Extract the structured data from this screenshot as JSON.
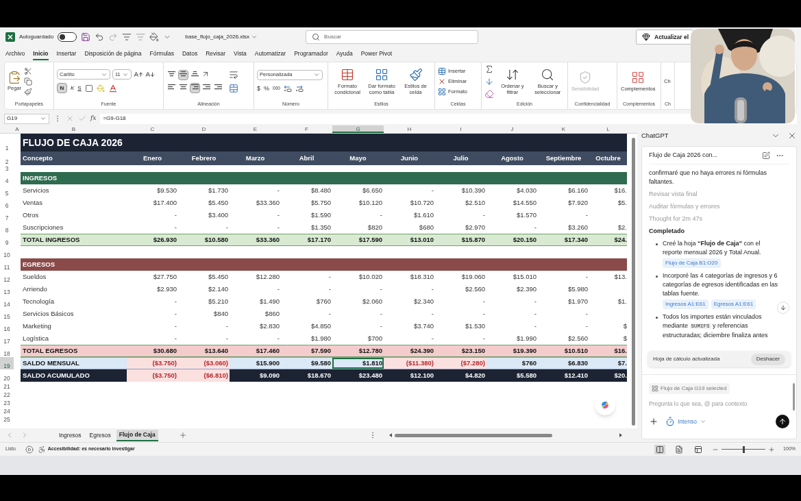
{
  "title_bar": {
    "autosave_label": "Autoguardado",
    "autosave_on": false,
    "file_name": "base_flujo_caja_2026.xlsx",
    "search_placeholder": "Buscar",
    "update_button": "Actualizar el"
  },
  "menu_tabs": [
    {
      "label": "Archivo",
      "selected": false
    },
    {
      "label": "Inicio",
      "selected": true
    },
    {
      "label": "Insertar",
      "selected": false
    },
    {
      "label": "Disposición de página",
      "selected": false
    },
    {
      "label": "Fórmulas",
      "selected": false
    },
    {
      "label": "Datos",
      "selected": false
    },
    {
      "label": "Revisar",
      "selected": false
    },
    {
      "label": "Vista",
      "selected": false
    },
    {
      "label": "Automatizar",
      "selected": false
    },
    {
      "label": "Programador",
      "selected": false
    },
    {
      "label": "Ayuda",
      "selected": false
    },
    {
      "label": "Power Pivot",
      "selected": false
    }
  ],
  "ribbon": {
    "clipboard": {
      "label": "Portapapeles",
      "paste": "Pegar"
    },
    "font": {
      "label": "Fuente",
      "family": "Carlito",
      "size": "11",
      "bold": "N",
      "bold_on": true,
      "italic": "K",
      "underline": "S"
    },
    "alignment": {
      "label": "Alineación",
      "middle_on": true,
      "right_on": true
    },
    "number": {
      "label": "Número",
      "format": "Personalizada",
      "currency": "$",
      "percent": "%",
      "thousands": "000"
    },
    "styles": {
      "label": "Estilos",
      "buttons": [
        "Formato condicional",
        "Dar formato como tabla",
        "Estilos de celda"
      ]
    },
    "cells": {
      "label": "Celdas",
      "buttons": [
        "Insertar",
        "Eliminar",
        "Formato"
      ]
    },
    "editing": {
      "label": "Edición",
      "buttons": [
        "Ordenar y filtrar",
        "Buscar y seleccionar"
      ]
    },
    "sensitivity": {
      "label": "Confidencialidad",
      "button": "Sensibilidad",
      "disabled": true
    },
    "addins": {
      "label": "Complementos",
      "button": "Complementos"
    },
    "partial": {
      "label": "Ch",
      "button": "Ch"
    }
  },
  "formula_bar": {
    "cell": "G19",
    "fx": "fx",
    "formula": "=G9-G18"
  },
  "columns": [
    {
      "letter": "A",
      "selected": false
    },
    {
      "letter": "B",
      "selected": false
    },
    {
      "letter": "C",
      "selected": false
    },
    {
      "letter": "D",
      "selected": false
    },
    {
      "letter": "E",
      "selected": false
    },
    {
      "letter": "F",
      "selected": false
    },
    {
      "letter": "G",
      "selected": true
    },
    {
      "letter": "H",
      "selected": false
    },
    {
      "letter": "I",
      "selected": false
    },
    {
      "letter": "J",
      "selected": false
    },
    {
      "letter": "K",
      "selected": false
    },
    {
      "letter": "L",
      "selected": false
    }
  ],
  "sheet": {
    "rows": [
      {
        "kind": "title",
        "num": "1",
        "label": "FLUJO DE CAJA 2026"
      },
      {
        "kind": "header",
        "num": "2",
        "label": "Concepto",
        "cells": [
          "Enero",
          "Febrero",
          "Marzo",
          "Abril",
          "Mayo",
          "Junio",
          "Julio",
          "Agosto",
          "Septiembre",
          "Octubre"
        ]
      },
      {
        "kind": "spacer",
        "num": "3"
      },
      {
        "kind": "section",
        "num": "4",
        "label": "INGRESOS",
        "color": "#2f6b4f"
      },
      {
        "kind": "data",
        "num": "5",
        "label": "Servicios",
        "cells": [
          "$9.530",
          "$1.730",
          "-",
          "$8.480",
          "$6.650",
          "-",
          "$10.390",
          "$4.030",
          "$6.160",
          "$16."
        ]
      },
      {
        "kind": "data",
        "num": "6",
        "label": "Ventas",
        "cells": [
          "$17.400",
          "$5.450",
          "$33.360",
          "$5.750",
          "$10.120",
          "$10.720",
          "$2.510",
          "$14.550",
          "$7.920",
          "$5."
        ]
      },
      {
        "kind": "data",
        "num": "7",
        "label": "Otros",
        "cells": [
          "-",
          "$3.400",
          "-",
          "$1.590",
          "-",
          "$1.610",
          "-",
          "$1.570",
          "-",
          null
        ]
      },
      {
        "kind": "data",
        "num": "8",
        "label": "Suscripciones",
        "cells": [
          "-",
          "-",
          "-",
          "$1.350",
          "$820",
          "$680",
          "$2.970",
          "-",
          "$3.260",
          "$2."
        ]
      },
      {
        "kind": "total",
        "num": "9",
        "label": "TOTAL INGRESOS",
        "color": "#d9ead3",
        "cells": [
          "$26.930",
          "$10.580",
          "$33.360",
          "$17.170",
          "$17.590",
          "$13.010",
          "$15.870",
          "$20.150",
          "$17.340",
          "$24."
        ]
      },
      {
        "kind": "blank",
        "num": "10"
      },
      {
        "kind": "section",
        "num": "11",
        "label": "EGRESOS",
        "color": "#8b4a4a"
      },
      {
        "kind": "data",
        "num": "12",
        "label": "Sueldos",
        "cells": [
          "$27.750",
          "$5.450",
          "$12.280",
          "-",
          "$10.020",
          "$18.310",
          "$19.060",
          "$15.010",
          "-",
          "$13."
        ]
      },
      {
        "kind": "data",
        "num": "13",
        "label": "Arriendo",
        "cells": [
          "$2.930",
          "$2.140",
          "-",
          "-",
          "-",
          "-",
          "$2.560",
          "$2.390",
          "$5.980",
          null
        ]
      },
      {
        "kind": "data",
        "num": "14",
        "label": "Tecnología",
        "cells": [
          "-",
          "$5.210",
          "$1.490",
          "$760",
          "$2.060",
          "$2.340",
          "-",
          "-",
          "$1.970",
          "$1."
        ]
      },
      {
        "kind": "data",
        "num": "15",
        "label": "Servicios Básicos",
        "cells": [
          "-",
          "$840",
          "$860",
          "-",
          "-",
          "-",
          "-",
          "-",
          "-",
          null
        ]
      },
      {
        "kind": "data",
        "num": "16",
        "label": "Marketing",
        "cells": [
          "-",
          "-",
          "$2.830",
          "$4.850",
          "-",
          "$3.740",
          "$1.530",
          "-",
          "-",
          "$"
        ]
      },
      {
        "kind": "data",
        "num": "17",
        "label": "Logística",
        "cells": [
          "-",
          "-",
          "-",
          "$1.980",
          "$700",
          "-",
          "-",
          "$1.990",
          "$2.560",
          "$"
        ]
      },
      {
        "kind": "total",
        "num": "18",
        "label": "TOTAL EGRESOS",
        "color": "#f4cccc",
        "cells": [
          "$30.680",
          "$13.640",
          "$17.460",
          "$7.590",
          "$12.780",
          "$24.390",
          "$23.150",
          "$19.390",
          "$10.510",
          "$16."
        ]
      },
      {
        "kind": "balance",
        "num": "19",
        "label": "SALDO MENSUAL",
        "cells": [
          {
            "text": "($3.750)",
            "negative": true,
            "selected": false
          },
          {
            "text": "($3.060)",
            "negative": true,
            "selected": false
          },
          {
            "text": "$15.900",
            "negative": false,
            "selected": false
          },
          {
            "text": "$9.580",
            "negative": false,
            "selected": false
          },
          {
            "text": "$1.810",
            "negative": false,
            "selected": true
          },
          {
            "text": "($11.380)",
            "negative": true,
            "selected": false
          },
          {
            "text": "($7.280)",
            "negative": true,
            "selected": false
          },
          {
            "text": "$760",
            "negative": false,
            "selected": false
          },
          {
            "text": "$6.830",
            "negative": false,
            "selected": false
          },
          {
            "text": "$7.",
            "negative": false,
            "selected": false
          }
        ]
      },
      {
        "kind": "cumulative",
        "num": "20",
        "label": "SALDO ACUMULADO",
        "cells": [
          {
            "text": "($3.750)",
            "negative": true,
            "selected": false
          },
          {
            "text": "($6.810)",
            "negative": true,
            "selected": false
          },
          {
            "text": "$9.090",
            "negative": false,
            "selected": false
          },
          {
            "text": "$18.670",
            "negative": false,
            "selected": false
          },
          {
            "text": "$23.480",
            "negative": false,
            "selected": false
          },
          {
            "text": "$12.100",
            "negative": false,
            "selected": false
          },
          {
            "text": "$4.820",
            "negative": false,
            "selected": false
          },
          {
            "text": "$5.580",
            "negative": false,
            "selected": false
          },
          {
            "text": "$12.410",
            "negative": false,
            "selected": false
          },
          {
            "text": "$20.",
            "negative": false,
            "selected": false
          }
        ]
      },
      {
        "kind": "blank",
        "num": "21"
      },
      {
        "kind": "blank",
        "num": "22"
      },
      {
        "kind": "blank",
        "num": "23"
      },
      {
        "kind": "blank",
        "num": "24"
      },
      {
        "kind": "blank",
        "num": "25"
      }
    ]
  },
  "sheet_tabs": [
    {
      "label": "Ingresos",
      "selected": false
    },
    {
      "label": "Egresos",
      "selected": false
    },
    {
      "label": "Flujo de Caja",
      "selected": true
    }
  ],
  "status_bar": {
    "ready": "Listo",
    "accessibility": "Accesibilidad: es necesario investigar",
    "zoom": "100%",
    "zoom_slider": {
      "level": 0.5
    },
    "normal_view_on": true
  },
  "chat": {
    "title": "ChatGPT",
    "conversation": "Flujo de Caja 2026 con...",
    "intro": "confirmaré que no haya errores ni fórmulas faltantes.",
    "steps": [
      "Revisar vista final",
      "Auditar fórmulas y errores",
      "Thought for 2m 47s"
    ],
    "status": "Completado",
    "bullets": [
      {
        "text": "Creé la hoja **“Flujo de Caja”** con el reporte mensual 2026 y Total Anual.",
        "refs": [
          "Flujo de Caja B1:O20"
        ]
      },
      {
        "text": "Incorporé las 4 categorías de ingresos y 6 categorías de egresos identificadas en las tablas fuente.",
        "refs": [
          "Ingresos A1:E61",
          "Egresos A1:E61"
        ]
      },
      {
        "text": "Todos los importes están vinculados mediante",
        "code": "SUMIFS",
        "text_after": "y referencias estructuradas; diciembre finaliza antes"
      }
    ],
    "toast": {
      "text": "Hoja de cálculo actualizada",
      "action": "Deshacer"
    },
    "context_chip": "Flujo de Caja G19 selected",
    "placeholder": "Pregunta lo que sea, @ para contexto",
    "mode": "Intenso"
  }
}
